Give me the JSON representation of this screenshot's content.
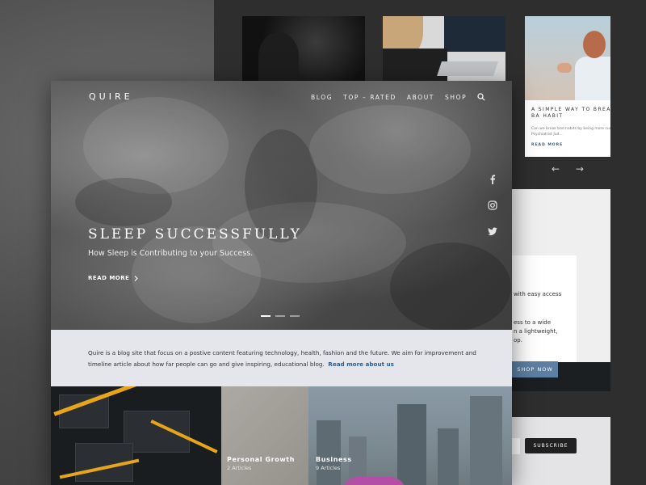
{
  "brand": {
    "logo": "QUIRE"
  },
  "nav": {
    "items": [
      {
        "label": "BLOG"
      },
      {
        "label": "TOP – RATED"
      },
      {
        "label": "ABOUT"
      },
      {
        "label": "SHOP"
      }
    ]
  },
  "hero": {
    "title": "SLEEP SUCCESSFULLY",
    "subtitle": "How Sleep is Contributing to your Success.",
    "read_more": "READ MORE",
    "slide_count": 3,
    "active_slide": 1
  },
  "social": {
    "icons": [
      "facebook-icon",
      "instagram-icon",
      "twitter-icon"
    ]
  },
  "about": {
    "text": "Quire is a blog site that focus on a postive content featuring technology, health, fashion and the future. We aim for improvement and timeline article about how far people can go and give inspiring, educational blog.",
    "link": "Read more about us"
  },
  "categories": [
    {
      "name": "Personal Growth",
      "count": "2 Articles"
    },
    {
      "name": "Business",
      "count": "9 Articles"
    }
  ],
  "side_card": {
    "title": "A SIMPLE WAY TO BREAK A BA HABIT",
    "excerpt": "Can we break bad habits by being more curious? Psychiatrist Jud...",
    "read_more": "READ MORE"
  },
  "carousel": {
    "prev": "←",
    "next": "→"
  },
  "shop_panel": {
    "line1": "with easy access",
    "line2": "ess to a wide",
    "line3": "n a lightweight,",
    "line4": "op.",
    "button": "SHOP NOW"
  },
  "subscribe": {
    "button": "SUBSCRIBE"
  },
  "colors": {
    "accent_blue": "#5d7fa3",
    "link_blue": "#2f5d8a",
    "about_bg": "#e5e5ec",
    "dark": "#212121"
  }
}
